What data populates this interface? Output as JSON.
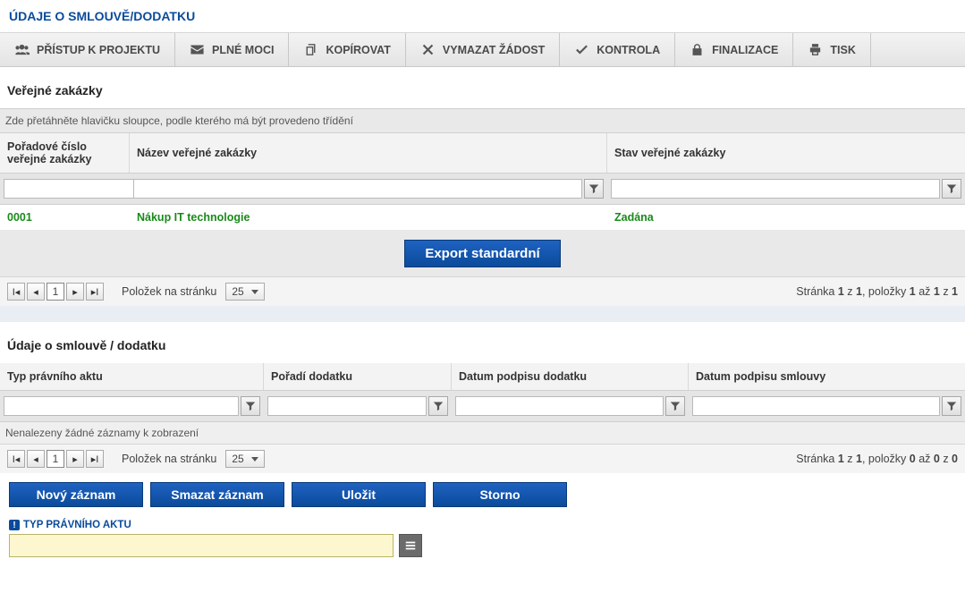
{
  "page_title": "ÚDAJE O SMLOUVĚ/DODATKU",
  "toolbar": {
    "access": "PŘÍSTUP K PROJEKTU",
    "powers": "PLNÉ MOCI",
    "copy": "KOPÍROVAT",
    "delete": "VYMAZAT ŽÁDOST",
    "check": "KONTROLA",
    "finalize": "FINALIZACE",
    "print": "TISK"
  },
  "section1": {
    "title": "Veřejné zakázky",
    "group_hint": "Zde přetáhněte hlavičku sloupce, podle kterého má být provedeno třídění",
    "headers": {
      "ord": "Pořadové číslo veřejné zakázky",
      "name": "Název veřejné zakázky",
      "state": "Stav veřejné zakázky"
    },
    "rows": [
      {
        "ord": "0001",
        "name": "Nákup IT technologie",
        "state": "Zadána"
      }
    ],
    "export_label": "Export standardní"
  },
  "pager": {
    "items_label": "Položek na stránku",
    "page_size": "25",
    "current_page": "1",
    "summary1_pre": "Stránka ",
    "summary1_mid": " z ",
    "summary1_items": ", položky ",
    "summary1_to": " až ",
    "summary1_of": " z ",
    "p1": {
      "page": "1",
      "pages": "1",
      "from": "1",
      "to": "1",
      "total": "1"
    },
    "p2": {
      "page": "1",
      "pages": "1",
      "from": "0",
      "to": "0",
      "total": "0"
    }
  },
  "section2": {
    "title": "Údaje o smlouvě / dodatku",
    "headers": {
      "type": "Typ právního aktu",
      "order": "Pořadí dodatku",
      "sign_add": "Datum podpisu dodatku",
      "sign_ctr": "Datum podpisu smlouvy"
    },
    "no_records": "Nenalezeny žádné záznamy k zobrazení"
  },
  "actions": {
    "new": "Nový záznam",
    "delete": "Smazat záznam",
    "save": "Uložit",
    "cancel": "Storno"
  },
  "form": {
    "type_label": "TYP PRÁVNÍHO AKTU",
    "type_value": ""
  }
}
